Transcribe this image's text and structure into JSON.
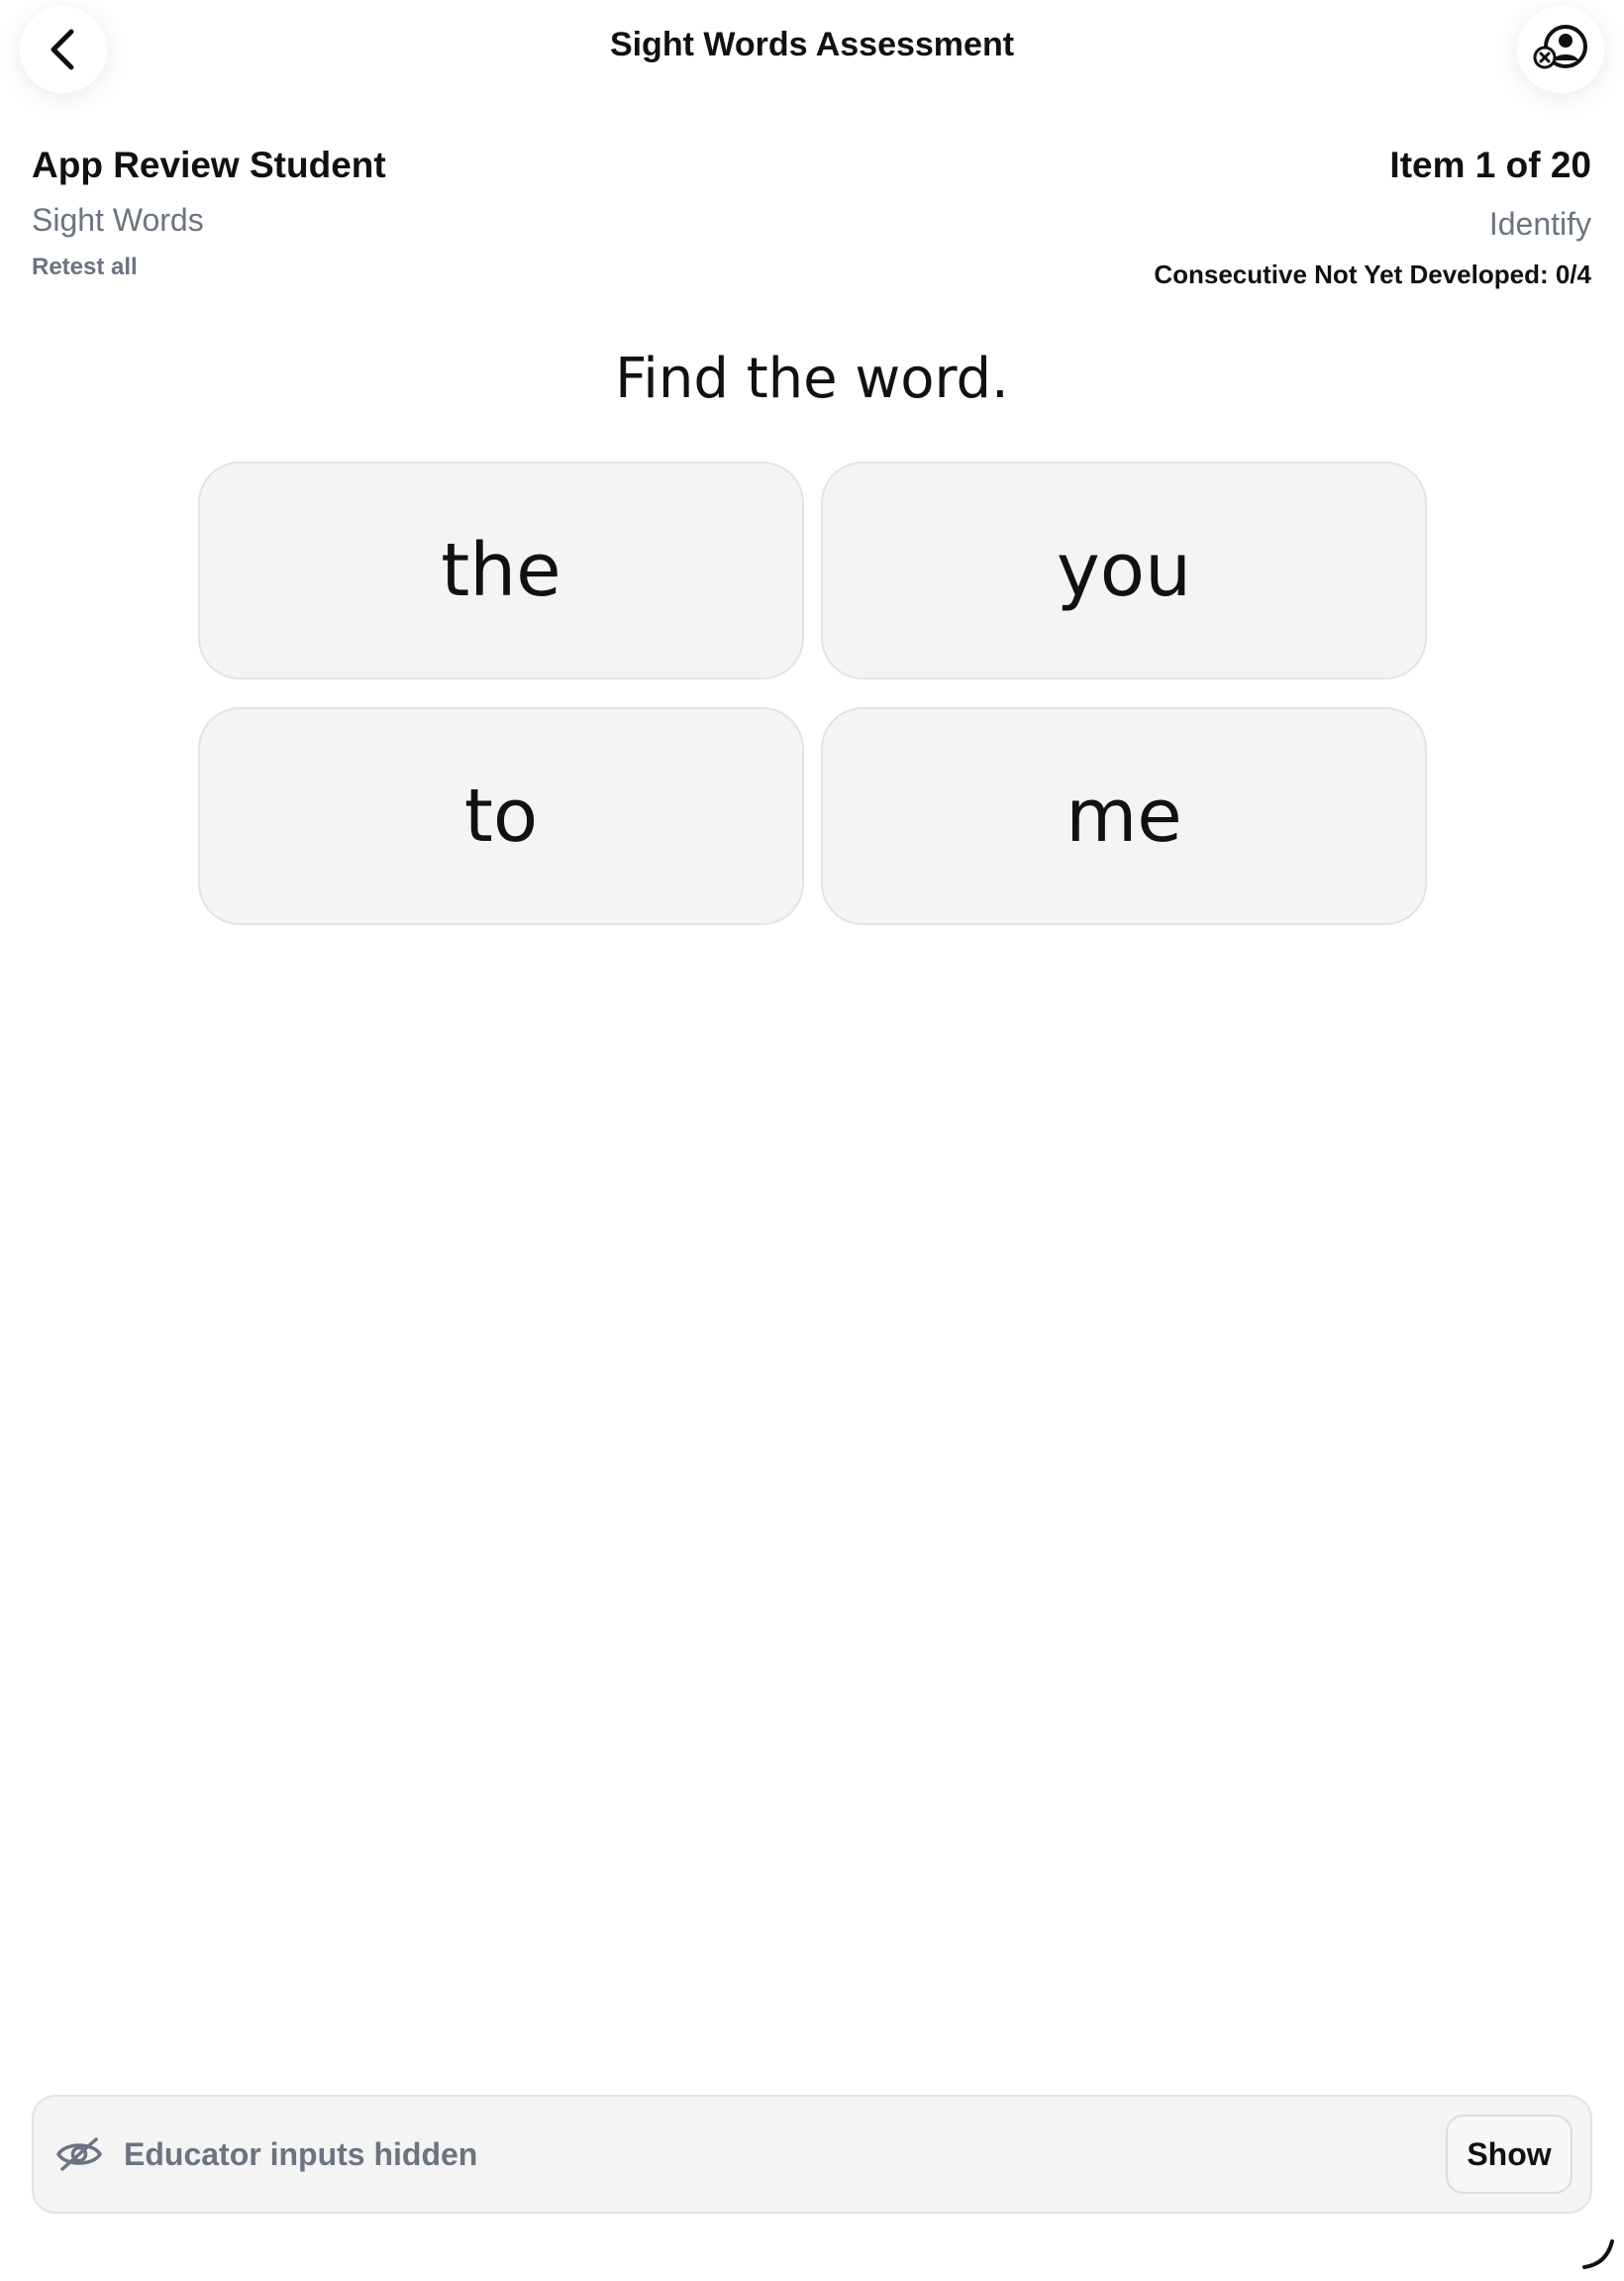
{
  "header": {
    "title": "Sight Words Assessment",
    "back_icon": "chevron-left-icon",
    "account_icon": "account-switch-icon"
  },
  "student": {
    "name": "App Review Student",
    "subject": "Sight Words",
    "retest_label": "Retest all"
  },
  "progress": {
    "item": "Item 1 of 20",
    "mode": "Identify",
    "consecutive": "Consecutive Not Yet Developed: 0/4"
  },
  "prompt": "Find the word.",
  "choices": [
    "the",
    "you",
    "to",
    "me"
  ],
  "educator": {
    "hidden_label": "Educator inputs hidden",
    "show_label": "Show",
    "icon": "eye-off-icon"
  },
  "colors": {
    "text": "#111111",
    "muted": "#6b7480",
    "tile_bg": "#f4f4f4",
    "tile_border": "#e3e3e3"
  }
}
